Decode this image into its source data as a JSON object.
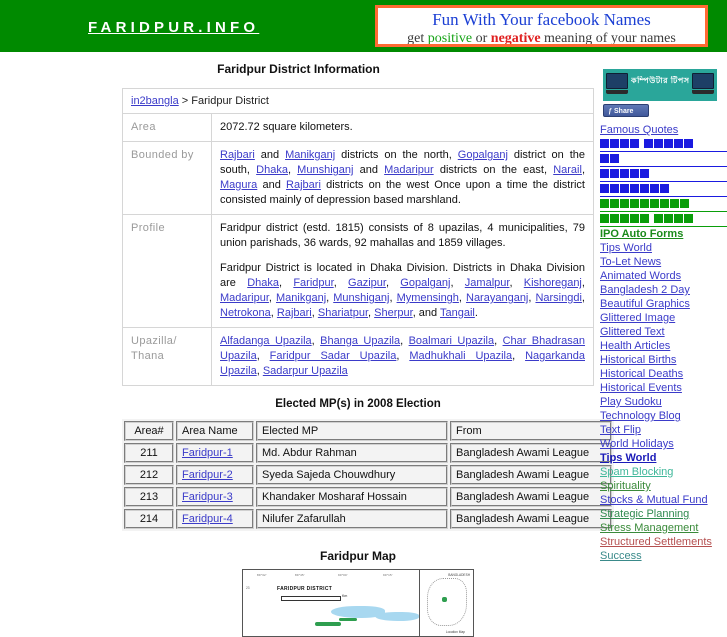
{
  "header": {
    "site_logo": "FARIDPUR.INFO",
    "ad": {
      "line1": "Fun With Your facebook Names",
      "line2_pre": "get ",
      "line2_positive": "positive",
      "line2_mid": " or ",
      "line2_negative": "negative",
      "line2_post": " meaning of your names"
    }
  },
  "page": {
    "title": "Faridpur District Information",
    "breadcrumb_link": "in2bangla",
    "breadcrumb_rest": "> Faridpur District"
  },
  "info_table": {
    "rows": [
      {
        "label": "Area",
        "paragraphs": [
          [
            {
              "t": "2072.72 square kilometers."
            }
          ]
        ]
      },
      {
        "label": "Bounded by",
        "paragraphs": [
          [
            {
              "t": "Rajbari",
              "link": true
            },
            {
              "t": " and "
            },
            {
              "t": "Manikganj",
              "link": true
            },
            {
              "t": " districts on the north, "
            },
            {
              "t": "Gopalganj",
              "link": true
            },
            {
              "t": " district on the south, "
            },
            {
              "t": "Dhaka",
              "link": true
            },
            {
              "t": ", "
            },
            {
              "t": "Munshiganj",
              "link": true
            },
            {
              "t": " and "
            },
            {
              "t": "Madaripur",
              "link": true
            },
            {
              "t": " districts on the east, "
            },
            {
              "t": "Narail",
              "link": true
            },
            {
              "t": ", "
            },
            {
              "t": "Magura",
              "link": true
            },
            {
              "t": " and "
            },
            {
              "t": "Rajbari",
              "link": true
            },
            {
              "t": " districts on the west Once upon a time the district consisted mainly of depression based marshland."
            }
          ]
        ]
      },
      {
        "label": "Profile",
        "paragraphs": [
          [
            {
              "t": "Faridpur district (estd. 1815) consists of 8 upazilas, 4 municipalities, 79 union parishads, 36 wards, 92 mahallas and 1859 villages."
            }
          ],
          [
            {
              "t": "Faridpur District is located in Dhaka Division. Districts in Dhaka Division are "
            },
            {
              "t": "Dhaka",
              "link": true
            },
            {
              "t": ", "
            },
            {
              "t": "Faridpur",
              "link": true
            },
            {
              "t": ", "
            },
            {
              "t": "Gazipur",
              "link": true
            },
            {
              "t": ", "
            },
            {
              "t": "Gopalganj",
              "link": true
            },
            {
              "t": ", "
            },
            {
              "t": "Jamalpur",
              "link": true
            },
            {
              "t": ", "
            },
            {
              "t": "Kishoreganj",
              "link": true
            },
            {
              "t": ", "
            },
            {
              "t": "Madaripur",
              "link": true
            },
            {
              "t": ", "
            },
            {
              "t": "Manikganj",
              "link": true
            },
            {
              "t": ", "
            },
            {
              "t": "Munshiganj",
              "link": true
            },
            {
              "t": ", "
            },
            {
              "t": "Mymensingh",
              "link": true
            },
            {
              "t": ", "
            },
            {
              "t": "Narayanganj",
              "link": true
            },
            {
              "t": ", "
            },
            {
              "t": "Narsingdi",
              "link": true
            },
            {
              "t": ", "
            },
            {
              "t": "Netrokona",
              "link": true
            },
            {
              "t": ", "
            },
            {
              "t": "Rajbari",
              "link": true
            },
            {
              "t": ", "
            },
            {
              "t": "Shariatpur",
              "link": true
            },
            {
              "t": ", "
            },
            {
              "t": "Sherpur",
              "link": true
            },
            {
              "t": ", and "
            },
            {
              "t": "Tangail",
              "link": true
            },
            {
              "t": "."
            }
          ]
        ]
      },
      {
        "label": "Upazilla/ Thana",
        "paragraphs": [
          [
            {
              "t": "Alfadanga Upazila",
              "link": true
            },
            {
              "t": ", "
            },
            {
              "t": "Bhanga Upazila",
              "link": true
            },
            {
              "t": ", "
            },
            {
              "t": "Boalmari Upazila",
              "link": true
            },
            {
              "t": ", "
            },
            {
              "t": "Char Bhadrasan Upazila",
              "link": true
            },
            {
              "t": ", "
            },
            {
              "t": "Faridpur Sadar Upazila",
              "link": true
            },
            {
              "t": ", "
            },
            {
              "t": "Madhukhali Upazila",
              "link": true
            },
            {
              "t": ", "
            },
            {
              "t": "Nagarkanda Upazila",
              "link": true
            },
            {
              "t": ", "
            },
            {
              "t": "Sadarpur Upazila",
              "link": true
            }
          ]
        ]
      }
    ]
  },
  "mp_table": {
    "title": "Elected MP(s) in 2008 Election",
    "headers": [
      "Area#",
      "Area Name",
      "Elected MP",
      "From"
    ],
    "rows": [
      {
        "area_no": "211",
        "area_name": "Faridpur-1",
        "mp": "Md. Abdur Rahman",
        "from": "Bangladesh Awami League"
      },
      {
        "area_no": "212",
        "area_name": "Faridpur-2",
        "mp": "Syeda Sajeda Chouwdhury",
        "from": "Bangladesh Awami League"
      },
      {
        "area_no": "213",
        "area_name": "Faridpur-3",
        "mp": "Khandaker Mosharaf Hossain",
        "from": "Bangladesh Awami League"
      },
      {
        "area_no": "214",
        "area_name": "Faridpur-4",
        "mp": "Nilufer Zafarullah",
        "from": "Bangladesh Awami League"
      }
    ]
  },
  "map": {
    "title": "Faridpur Map",
    "district_label": "FARIDPUR DISTRICT",
    "scale_label": "Km",
    "inset_label": "BANGLADESH",
    "inset_caption": "Location Map",
    "y_axis_label": "23",
    "ticks": [
      "89°32'",
      "89°45'",
      "90°00'",
      "90°15'"
    ]
  },
  "sidebar": {
    "promo": {
      "text": "কম্পিউটার টিপস",
      "share_label": "Share",
      "share_glyph": "f",
      "bg_color": "#2aa69a"
    },
    "items": [
      {
        "label": "Famous Quotes",
        "color": "#3b3bc9",
        "type": "text"
      },
      {
        "type": "tofu",
        "color": "#1a1ae0",
        "groups": [
          4,
          5
        ]
      },
      {
        "type": "tofu",
        "color": "#1a1ae0",
        "groups": [
          2
        ]
      },
      {
        "type": "tofu",
        "color": "#1a1ae0",
        "groups": [
          5
        ]
      },
      {
        "type": "tofu",
        "color": "#1a1ae0",
        "groups": [
          7
        ]
      },
      {
        "type": "tofu",
        "color": "#0a9e0a",
        "groups": [
          9
        ]
      },
      {
        "type": "tofu",
        "color": "#0a9e0a",
        "groups": [
          5,
          4
        ]
      },
      {
        "label": "IPO Auto Forms",
        "color": "#1a8a1a",
        "type": "text",
        "bold": true
      },
      {
        "label": "Tips World",
        "color": "#3b3bc9",
        "type": "text"
      },
      {
        "label": "To-Let News",
        "color": "#3b3bc9",
        "type": "text"
      },
      {
        "label": "Animated Words",
        "color": "#3b3bc9",
        "type": "text"
      },
      {
        "label": "Bangladesh 2 Day",
        "color": "#3b3bc9",
        "type": "text"
      },
      {
        "label": "Beautiful Graphics",
        "color": "#3b3bc9",
        "type": "text"
      },
      {
        "label": "Glittered Image",
        "color": "#3b3bc9",
        "type": "text"
      },
      {
        "label": "Glittered Text",
        "color": "#3b3bc9",
        "type": "text"
      },
      {
        "label": "Health Articles",
        "color": "#3b3bc9",
        "type": "text"
      },
      {
        "label": "Historical Births",
        "color": "#3b3bc9",
        "type": "text"
      },
      {
        "label": "Historical Deaths",
        "color": "#3b3bc9",
        "type": "text"
      },
      {
        "label": "Historical Events",
        "color": "#3b3bc9",
        "type": "text"
      },
      {
        "label": "Play Sudoku",
        "color": "#3b3bc9",
        "type": "text"
      },
      {
        "label": "Technology Blog",
        "color": "#3b3bc9",
        "type": "text"
      },
      {
        "label": "Text Flip",
        "color": "#3b3bc9",
        "type": "text"
      },
      {
        "label": "World Holidays",
        "color": "#3b3bc9",
        "type": "text"
      },
      {
        "label": "Tips World",
        "color": "#1a1ab8",
        "type": "text",
        "bold": true
      },
      {
        "label": "Spam Blocking",
        "color": "#3fb79a",
        "type": "text"
      },
      {
        "label": "Spirituality",
        "color": "#3a8a3a",
        "type": "text"
      },
      {
        "label": "Stocks & Mutual Fund",
        "color": "#3b3bc9",
        "type": "text"
      },
      {
        "label": "Strategic Planning",
        "color": "#2f8a4f",
        "type": "text"
      },
      {
        "label": "Stress Management",
        "color": "#3a8a3a",
        "type": "text"
      },
      {
        "label": "Structured Settlements",
        "color": "#b55050",
        "type": "text"
      },
      {
        "label": "Success",
        "color": "#3a8a8a",
        "type": "text"
      }
    ]
  }
}
